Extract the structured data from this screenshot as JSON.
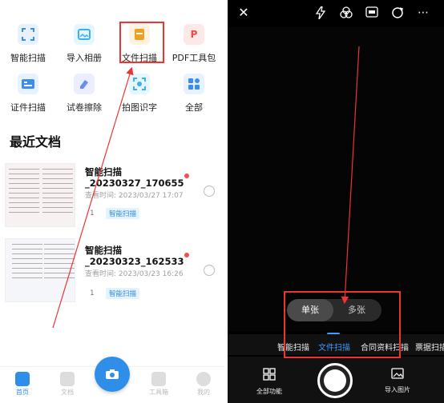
{
  "left": {
    "tools": [
      {
        "label": "智能扫描",
        "icon": "smart-scan-icon",
        "color": "#3b8ef0"
      },
      {
        "label": "导入相册",
        "icon": "album-import-icon",
        "color": "#3bb0f0"
      },
      {
        "label": "文件扫描",
        "icon": "file-scan-icon",
        "color": "#f0a020"
      },
      {
        "label": "PDF工具包",
        "icon": "pdf-toolkit-icon",
        "color": "#f04a4a"
      },
      {
        "label": "证件扫描",
        "icon": "id-scan-icon",
        "color": "#3b8ef0"
      },
      {
        "label": "试卷擦除",
        "icon": "paper-erase-icon",
        "color": "#6a8ef0"
      },
      {
        "label": "拍图识字",
        "icon": "ocr-icon",
        "color": "#3bb0f0"
      },
      {
        "label": "全部",
        "icon": "all-apps-icon",
        "color": "#3b8ef0"
      }
    ],
    "section_title": "最近文档",
    "docs": [
      {
        "title_line1": "智能扫描",
        "title_line2": "_20230327_170655",
        "time": "查看时间: 2023/03/27 17:07",
        "pages": "1",
        "tag": "智能扫描"
      },
      {
        "title_line1": "智能扫描",
        "title_line2": "_20230323_162533",
        "time": "查看时间: 2023/03/23 16:26",
        "pages": "1",
        "tag": "智能扫描"
      }
    ],
    "nav": [
      {
        "label": "首页",
        "active": true
      },
      {
        "label": "文档",
        "active": false
      },
      {
        "label": "工具箱",
        "active": false
      },
      {
        "label": "我的",
        "active": false
      }
    ]
  },
  "right": {
    "top_icons": [
      "close-icon",
      "flash-icon",
      "filter-icon",
      "hd-icon",
      "rotate-icon",
      "more-icon"
    ],
    "toggle": {
      "single": "单张",
      "multi": "多张"
    },
    "modes": [
      "智能扫描",
      "文件扫描",
      "合同资料扫描",
      "票据扫描"
    ],
    "active_mode": "文件扫描",
    "bottom": {
      "all_functions": "全部功能",
      "import_image": "导入图片"
    }
  },
  "colors": {
    "accent": "#2f8fe8",
    "highlight": "#e33333",
    "tag_blue": "#2d8fde"
  }
}
